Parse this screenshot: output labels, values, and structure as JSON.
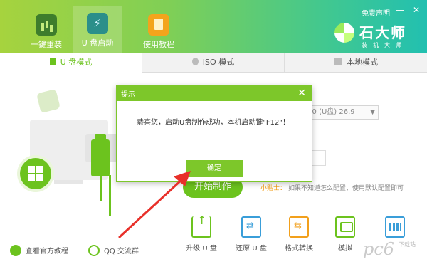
{
  "header": {
    "nav": [
      {
        "label": "一键重装",
        "icon": "bar-chart-icon"
      },
      {
        "label": "U 盘启动",
        "icon": "usb-flash-icon"
      },
      {
        "label": "使用教程",
        "icon": "book-icon"
      }
    ],
    "disclaimer": "免责声明",
    "minimize": "—",
    "close": "✕",
    "logo_text": "石大师",
    "logo_sub": "装机大师"
  },
  "tabs": [
    {
      "label": "U 盘模式",
      "active": true
    },
    {
      "label": "ISO 模式",
      "active": false
    },
    {
      "label": "本地模式",
      "active": false
    }
  ],
  "device_select": "3.0 (U盘) 26.9",
  "start_label": "开始制作",
  "tip_key": "小贴士：",
  "tip_text": "如果不知道怎么配置，使用默认配置即可",
  "tools": [
    {
      "label": "升级 U 盘",
      "icon": "upgrade-usb-icon"
    },
    {
      "label": "还原 U 盘",
      "icon": "restore-usb-icon"
    },
    {
      "label": "格式转换",
      "icon": "format-convert-icon"
    },
    {
      "label": "模拟",
      "icon": "simulate-icon"
    },
    {
      "label": "",
      "icon": "keyboard-icon"
    }
  ],
  "links": {
    "website": "查看官方教程",
    "qq": "QQ 交流群"
  },
  "modal": {
    "title": "提示",
    "close": "✕",
    "message": "恭喜您，启动U盘制作成功，本机启动键\"F12\"！",
    "ok": "确定"
  },
  "watermark": {
    "text": "pc6",
    "sub": "下载站"
  },
  "colors": {
    "accent": "#6cc31e",
    "modal_bar": "#7dc72a",
    "annotation_arrow": "#e8302a"
  }
}
